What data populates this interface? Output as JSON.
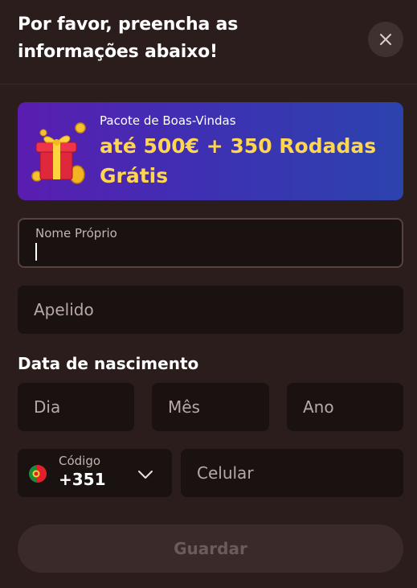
{
  "header": {
    "title": "Por favor, preencha as informações abaixo!"
  },
  "banner": {
    "subtitle": "Pacote de Boas-Vindas",
    "headline": "até 500€ + 350 Rodadas Grátis",
    "icon": "gift-icon"
  },
  "form": {
    "first_name": {
      "label": "Nome Próprio",
      "value": ""
    },
    "last_name": {
      "placeholder": "Apelido"
    },
    "birth_date": {
      "label": "Data de nascimento",
      "day_placeholder": "Dia",
      "month_placeholder": "Mês",
      "year_placeholder": "Ano"
    },
    "phone": {
      "code_label": "Código",
      "code_value": "+351",
      "flag_icon": "portugal-flag-icon",
      "placeholder": "Celular"
    },
    "save_label": "Guardar"
  },
  "colors": {
    "background": "#2b1d1c",
    "field_background": "#1a1111",
    "banner_accent": "#ffd64d",
    "banner_gradient_start": "#5a1db0",
    "banner_gradient_end": "#2c43ad"
  }
}
